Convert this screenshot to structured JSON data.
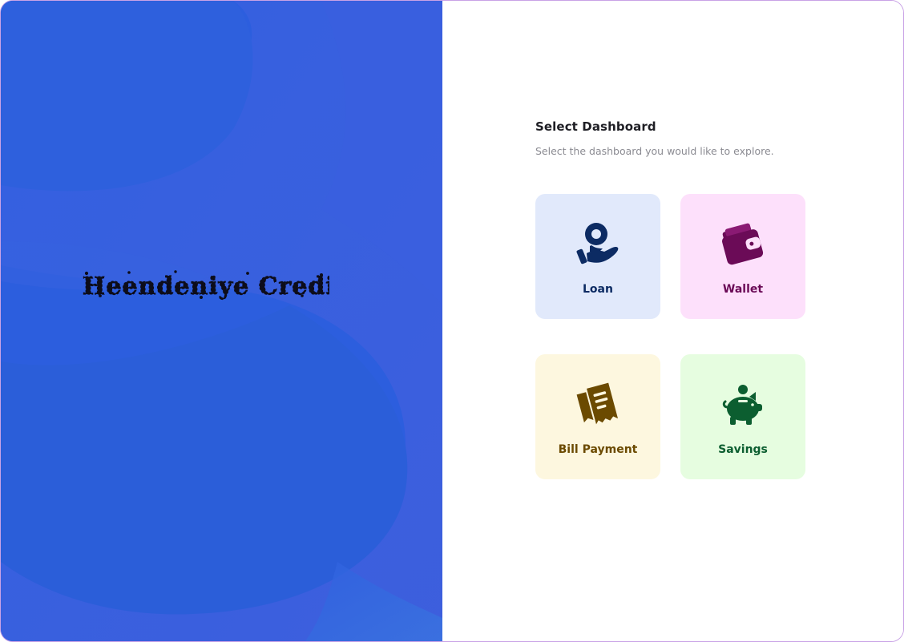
{
  "brand": {
    "name": "Heendeniye Credits",
    "panel_color": "#2c5ede"
  },
  "dashboard_select": {
    "title": "Select Dashboard",
    "subtitle": "Select the dashboard you would like to explore."
  },
  "cards": [
    {
      "id": "loan",
      "label": "Loan",
      "icon": "loan-hand-coin-icon",
      "bg": "#e1e9fb",
      "fg": "#0c2b63"
    },
    {
      "id": "wallet",
      "label": "Wallet",
      "icon": "wallet-icon",
      "bg": "#fde0fb",
      "fg": "#6b0b57"
    },
    {
      "id": "bill",
      "label": "Bill Payment",
      "icon": "receipt-icon",
      "bg": "#fdf7df",
      "fg": "#6b4a00"
    },
    {
      "id": "savings",
      "label": "Savings",
      "icon": "piggy-bank-icon",
      "bg": "#e6fde0",
      "fg": "#0c5e30"
    }
  ]
}
